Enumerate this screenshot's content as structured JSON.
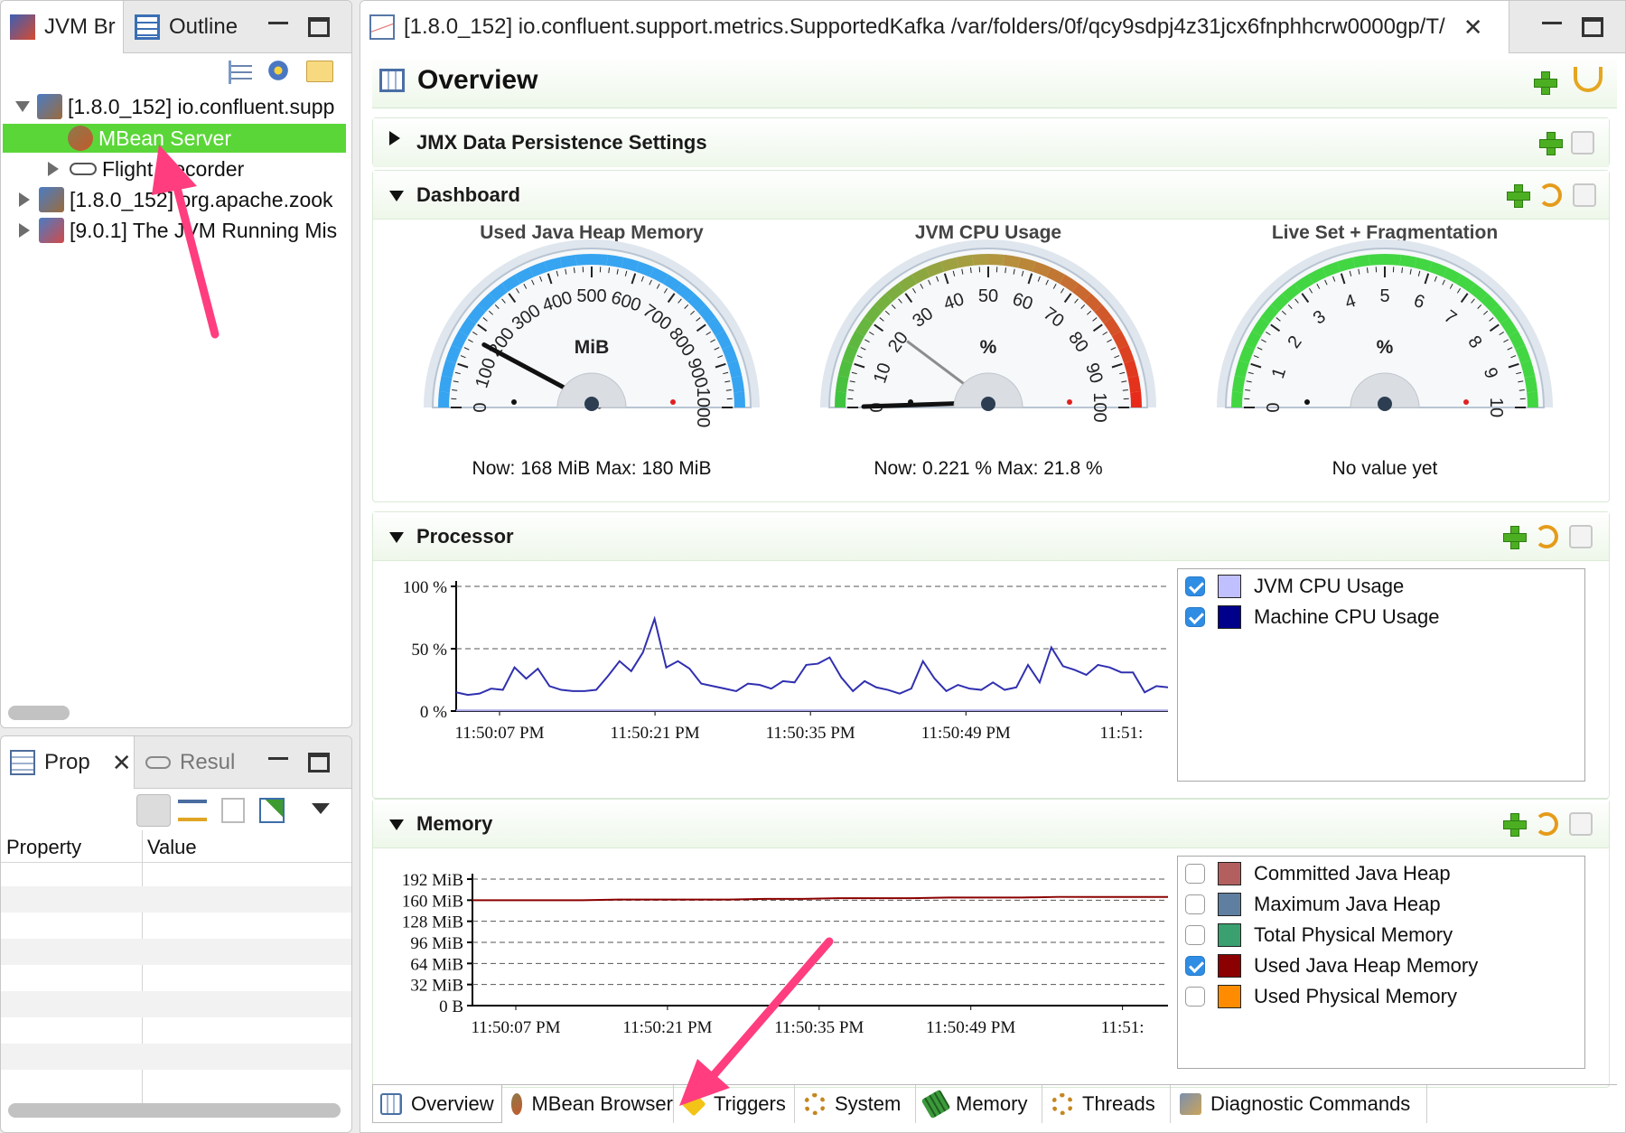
{
  "left_top": {
    "tabs": [
      {
        "label": "JVM Br"
      },
      {
        "label": "Outline"
      }
    ],
    "tree": [
      {
        "label": "[1.8.0_152] io.confluent.supp"
      },
      {
        "label": "MBean Server"
      },
      {
        "label": "Flight Recorder"
      },
      {
        "label": "[1.8.0_152] org.apache.zook"
      },
      {
        "label": "[9.0.1] The JVM Running Mis"
      }
    ]
  },
  "left_bottom": {
    "tabs": [
      {
        "label": "Prop"
      },
      {
        "label": "Resul"
      }
    ],
    "columns": [
      "Property",
      "Value"
    ]
  },
  "editor": {
    "tab_title": "[1.8.0_152] io.confluent.support.metrics.SupportedKafka /var/folders/0f/qcy9sdpj4z31jcx6fnphhcrw0000gp/T/",
    "page_title": "Overview",
    "sections": {
      "jmx": "JMX Data Persistence Settings",
      "dashboard": "Dashboard",
      "processor": "Processor",
      "memory": "Memory"
    },
    "gauges": [
      {
        "title": "Used Java Heap Memory",
        "unit": "MiB",
        "ticks": [
          "0",
          "100",
          "200",
          "300",
          "400",
          "500",
          "600",
          "700",
          "800",
          "900",
          "1000"
        ],
        "min": 0,
        "max": 1000,
        "value": 168,
        "status": "Now: 168 MiB    Max: 180 MiB"
      },
      {
        "title": "JVM CPU Usage",
        "unit": "%",
        "ticks": [
          "0",
          "10",
          "20",
          "30",
          "40",
          "50",
          "60",
          "70",
          "80",
          "90",
          "100"
        ],
        "min": 0,
        "max": 100,
        "value": 0.221,
        "status": "Now: 0.221 %    Max: 21.8 %"
      },
      {
        "title": "Live Set + Fragmentation",
        "unit": "%",
        "ticks": [
          "0",
          "1",
          "2",
          "3",
          "4",
          "5",
          "6",
          "7",
          "8",
          "9",
          "10"
        ],
        "min": 0,
        "max": 10,
        "value": null,
        "status": "No value yet"
      }
    ],
    "processor_legend": [
      {
        "label": "JVM CPU Usage",
        "checked": true,
        "color": "#c0c0ff"
      },
      {
        "label": "Machine CPU Usage",
        "checked": true,
        "color": "#00008b"
      }
    ],
    "memory_legend": [
      {
        "label": "Committed Java Heap",
        "checked": false,
        "color": "#b45f5f"
      },
      {
        "label": "Maximum Java Heap",
        "checked": false,
        "color": "#5f7fa0"
      },
      {
        "label": "Total Physical Memory",
        "checked": false,
        "color": "#3aa070"
      },
      {
        "label": "Used Java Heap Memory",
        "checked": true,
        "color": "#8b0000"
      },
      {
        "label": "Used Physical Memory",
        "checked": false,
        "color": "#ff8c00"
      }
    ],
    "bottom_tabs": [
      {
        "label": "Overview"
      },
      {
        "label": "MBean Browser"
      },
      {
        "label": "Triggers"
      },
      {
        "label": "System"
      },
      {
        "label": "Memory"
      },
      {
        "label": "Threads"
      },
      {
        "label": "Diagnostic Commands"
      }
    ]
  },
  "chart_data": [
    {
      "type": "line",
      "name": "Processor",
      "y_ticks": [
        "0 %",
        "50 %",
        "100 %"
      ],
      "ylim": [
        0,
        100
      ],
      "x_ticks": [
        "11:50:07 PM",
        "11:50:21 PM",
        "11:50:35 PM",
        "11:50:49 PM",
        "11:51:"
      ],
      "series": [
        {
          "name": "Machine CPU Usage",
          "color": "#3030b0",
          "values": [
            15,
            13,
            14,
            18,
            17,
            35,
            26,
            34,
            20,
            17,
            16,
            16,
            17,
            28,
            40,
            32,
            47,
            74,
            35,
            40,
            34,
            22,
            20,
            18,
            16,
            22,
            21,
            18,
            24,
            23,
            37,
            38,
            43,
            27,
            16,
            24,
            19,
            17,
            14,
            18,
            40,
            26,
            16,
            21,
            18,
            17,
            23,
            17,
            19,
            37,
            23,
            51,
            36,
            33,
            29,
            37,
            35,
            31,
            31,
            15,
            20,
            19
          ]
        },
        {
          "name": "JVM CPU Usage",
          "color": "#a8a8e8",
          "values": [
            0.5,
            0.5,
            0.5,
            0.5,
            0.5,
            0.5,
            0.5,
            0.5,
            0.5,
            0.5,
            0.5,
            0.5,
            0.5,
            0.5,
            0.5,
            0.5,
            0.5,
            0.5,
            0.5,
            0.5,
            0.5,
            0.5,
            0.5,
            0.5,
            0.5,
            0.5,
            0.5,
            0.5,
            0.5,
            0.5,
            0.5,
            0.5,
            0.5,
            0.5,
            0.5,
            0.5,
            0.5,
            0.5,
            0.5,
            0.5,
            0.5,
            0.5,
            0.5,
            0.5,
            0.5,
            0.5,
            0.5,
            0.5,
            0.5,
            0.5,
            0.5,
            0.5,
            0.5,
            0.5,
            0.5,
            0.5,
            0.5,
            0.5,
            0.5,
            0.5,
            0.5,
            0.5
          ]
        }
      ],
      "grid": true
    },
    {
      "type": "line",
      "name": "Memory",
      "y_ticks": [
        "0 B",
        "32 MiB",
        "64 MiB",
        "96 MiB",
        "128 MiB",
        "160 MiB",
        "192 MiB"
      ],
      "ylim": [
        0,
        192
      ],
      "x_ticks": [
        "11:50:07 PM",
        "11:50:21 PM",
        "11:50:35 PM",
        "11:50:49 PM",
        "11:51:"
      ],
      "series": [
        {
          "name": "Used Java Heap Memory",
          "color": "#8b0000",
          "values": [
            160,
            160,
            160,
            160,
            161,
            161,
            161,
            161,
            162,
            162,
            163,
            163,
            163,
            164,
            164,
            164,
            165,
            165,
            165,
            165
          ]
        }
      ],
      "grid": true
    }
  ]
}
